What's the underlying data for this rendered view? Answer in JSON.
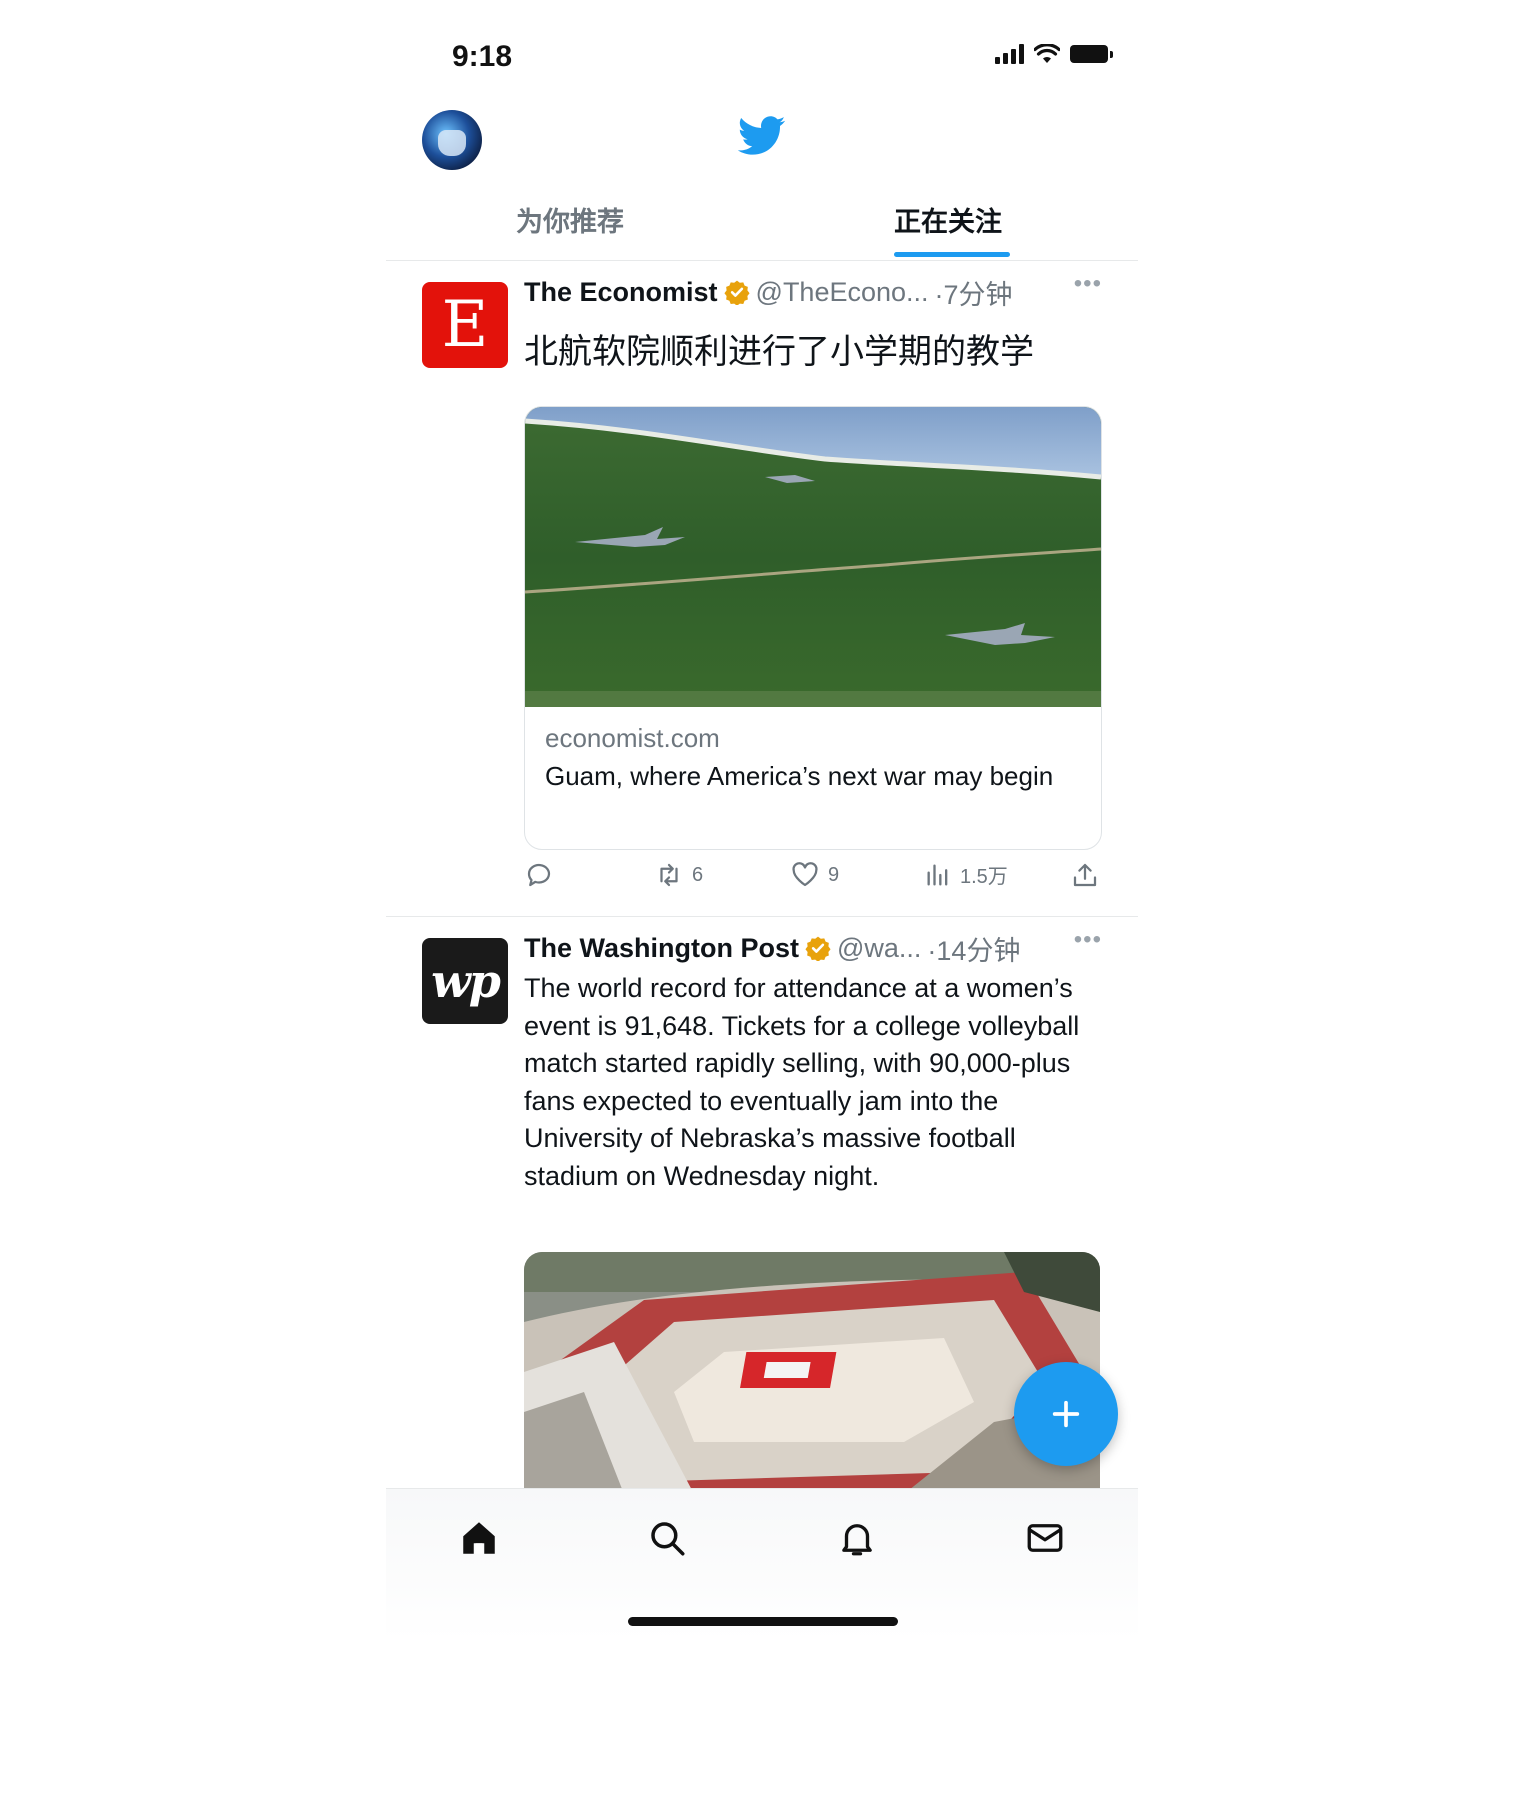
{
  "status_bar": {
    "time": "9:18"
  },
  "header": {
    "tabs": [
      {
        "label": "为你推荐",
        "active": false
      },
      {
        "label": "正在关注",
        "active": true
      }
    ]
  },
  "tweets": [
    {
      "avatar_letter": "E",
      "name": "The Economist",
      "handle": "@TheEcono...",
      "time": "·7分钟",
      "text": "北航软院顺利进行了小学期的教学",
      "card": {
        "domain": "economist.com",
        "title": "Guam, where America’s next war may begin"
      },
      "actions": {
        "retweets": "6",
        "likes": "9",
        "views": "1.5万"
      }
    },
    {
      "avatar_letter": "wp",
      "name": "The Washington Post",
      "handle": "@wa...",
      "time": "·14分钟",
      "text": "The world record for attendance at a women’s event is 91,648. Tickets for a college volleyball match started rapidly selling, with 90,000-plus fans expected to eventually jam into the University of Nebraska’s massive football stadium on Wednesday night."
    }
  ],
  "colors": {
    "accent": "#1d9bf0",
    "verified": "#e8a20c",
    "economist_red": "#e3120b"
  },
  "icons": [
    "twitter-bird-icon",
    "verified-badge-icon",
    "more-icon",
    "reply-icon",
    "retweet-icon",
    "like-icon",
    "views-icon",
    "share-icon",
    "compose-plus-icon",
    "home-icon",
    "search-icon",
    "notifications-icon",
    "messages-icon"
  ]
}
